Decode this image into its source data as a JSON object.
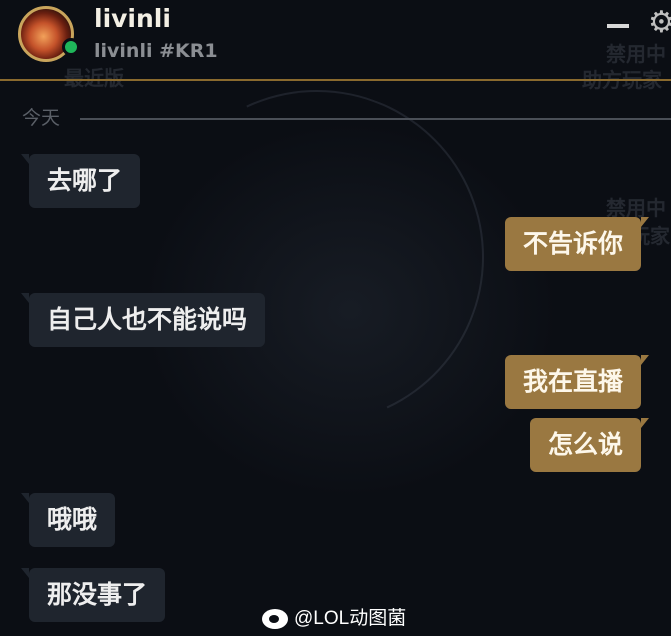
{
  "header": {
    "username": "livinli",
    "riot_id": "livinli #KR1",
    "status": "online",
    "status_color": "#1fb65a",
    "accent_color": "#8a6a2e"
  },
  "ghost_text": {
    "right_top_1": "禁用中",
    "right_top_2": "助方玩家",
    "left_top": "最近版",
    "right_mid_1": "禁用中",
    "right_mid_2": "玩家"
  },
  "chat": {
    "date_label": "今天",
    "messages": [
      {
        "from": "them",
        "text": "去哪了"
      },
      {
        "from": "me",
        "text": "不告诉你"
      },
      {
        "from": "them",
        "text": "自己人也不能说吗"
      },
      {
        "from": "me",
        "text": "我在直播"
      },
      {
        "from": "me",
        "text": "怎么说"
      },
      {
        "from": "them",
        "text": "哦哦"
      },
      {
        "from": "them",
        "text": "那没事了"
      }
    ]
  },
  "watermark": {
    "text": "@LOL动图菌",
    "icon": "weibo-icon"
  },
  "icons": {
    "minimize": "minimize-icon",
    "settings": "gear-icon"
  }
}
